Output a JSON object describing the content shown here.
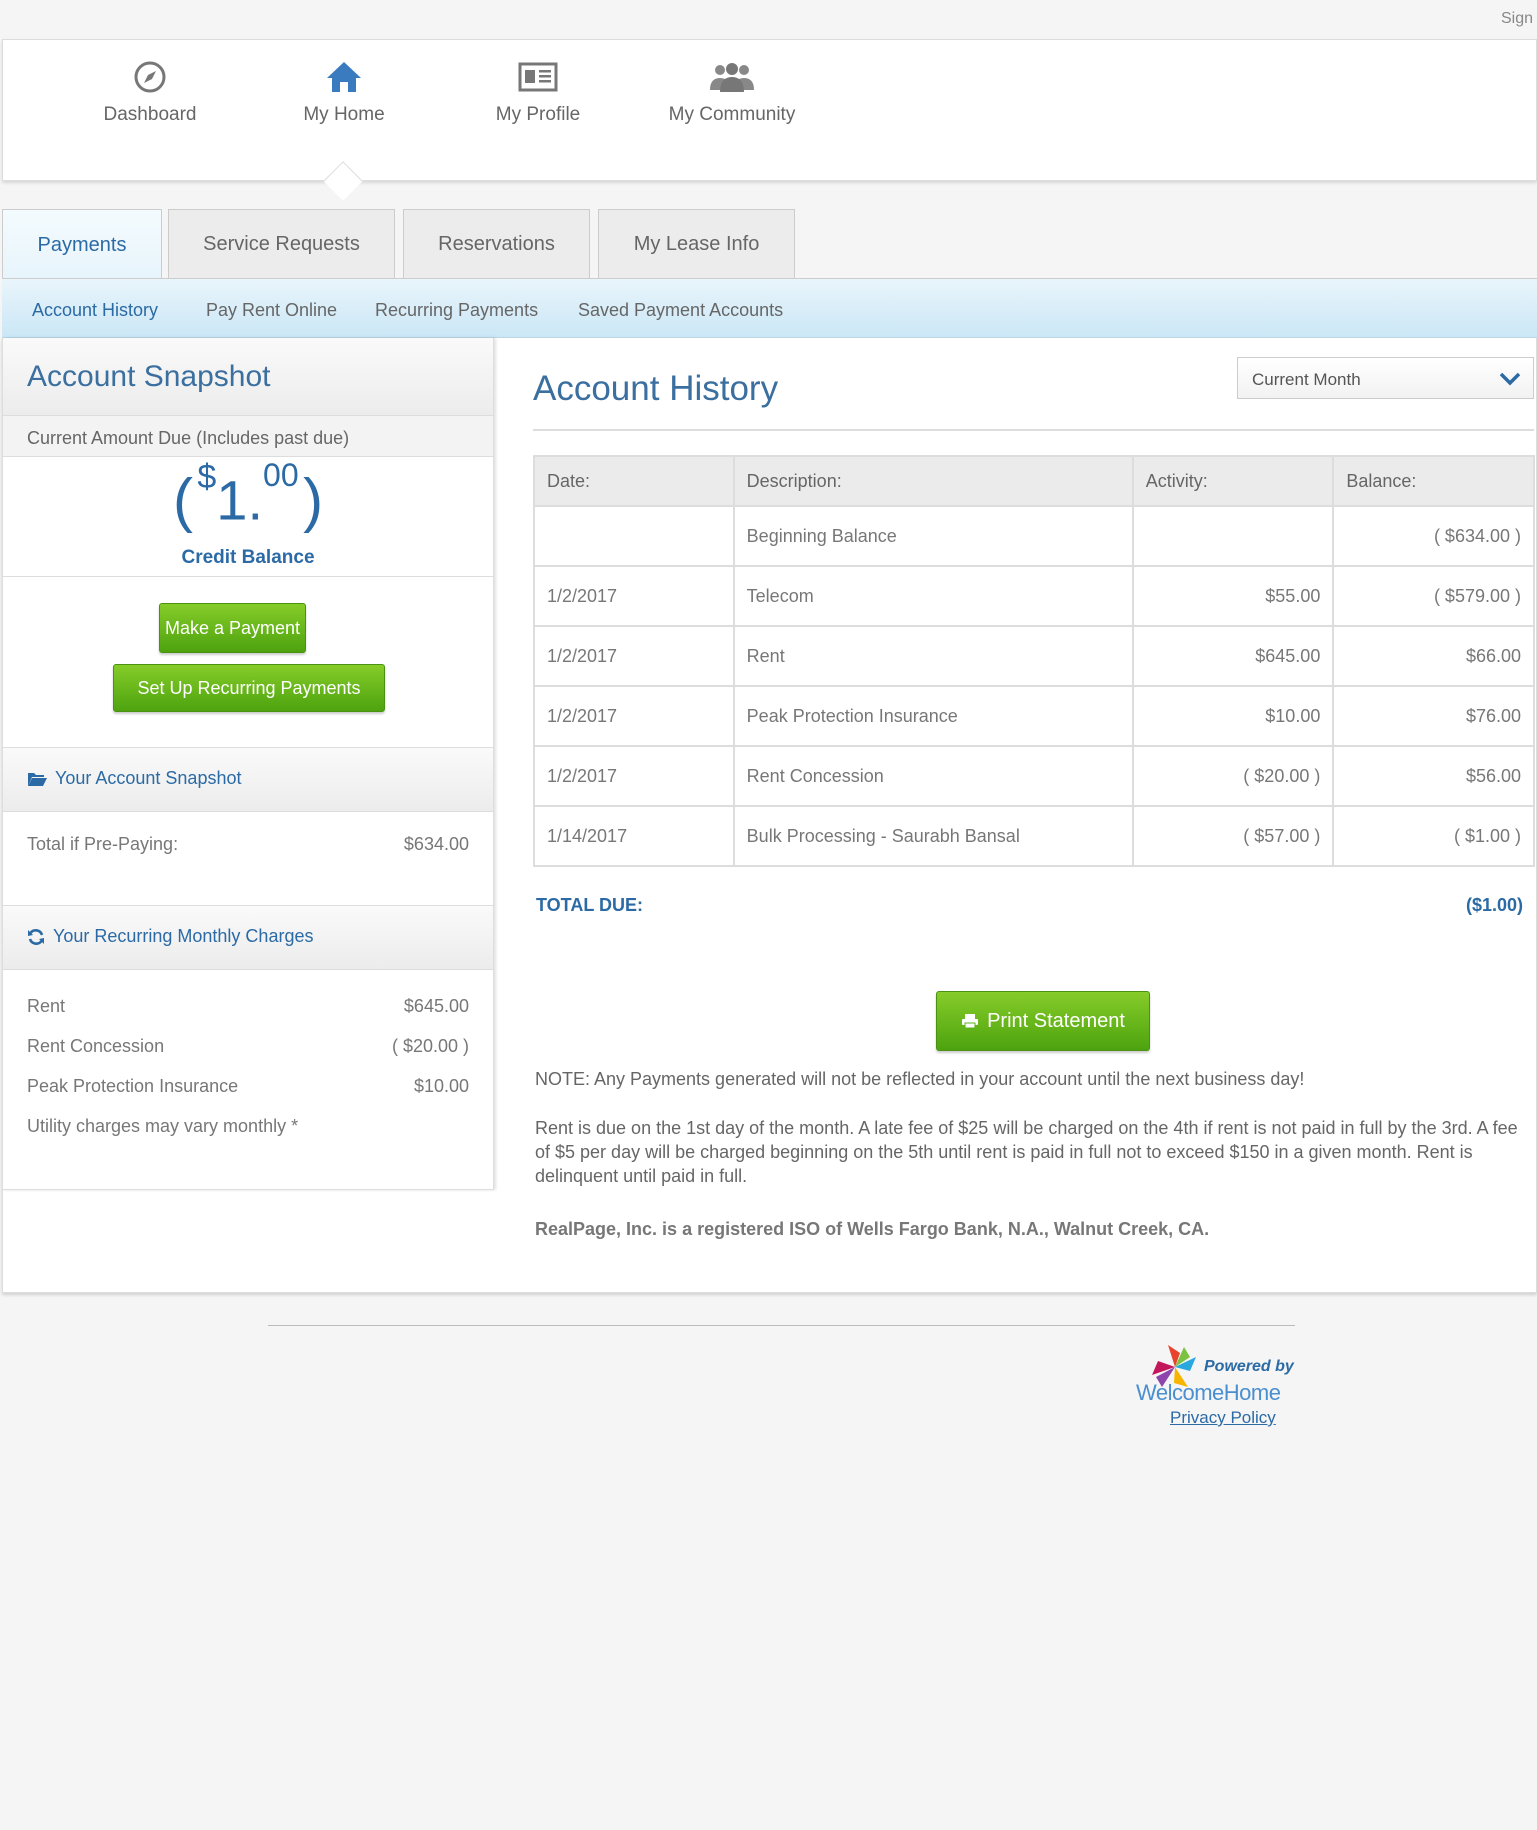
{
  "header": {
    "sign_in": "Sign"
  },
  "top_nav": [
    {
      "label": "Dashboard",
      "icon": "compass-icon"
    },
    {
      "label": "My Home",
      "icon": "home-icon"
    },
    {
      "label": "My Profile",
      "icon": "profile-card-icon"
    },
    {
      "label": "My Community",
      "icon": "community-icon"
    }
  ],
  "tabs": [
    {
      "label": "Payments",
      "active": true
    },
    {
      "label": "Service Requests"
    },
    {
      "label": "Reservations"
    },
    {
      "label": "My Lease Info"
    }
  ],
  "subnav": [
    {
      "label": "Account History",
      "active": true
    },
    {
      "label": "Pay Rent Online"
    },
    {
      "label": "Recurring Payments"
    },
    {
      "label": "Saved Payment Accounts"
    }
  ],
  "snapshot": {
    "title": "Account Snapshot",
    "due_label": "Current Amount Due (Includes past due)",
    "amount_open": "(",
    "amount_dollar": "$",
    "amount_whole": "1",
    "amount_sep": ".",
    "amount_cents": "00",
    "amount_close": ")",
    "credit_label": "Credit Balance",
    "pay_button": "Make a Payment",
    "recurring_button": "Set Up Recurring Payments",
    "account_snapshot_heading": "Your Account Snapshot",
    "prepay_label": "Total if Pre-Paying:",
    "prepay_value": "$634.00",
    "recurring_heading": "Your Recurring Monthly Charges",
    "charges": [
      {
        "label": "Rent",
        "value": "$645.00"
      },
      {
        "label": "Rent Concession",
        "value": "( $20.00 )"
      },
      {
        "label": "Peak Protection Insurance",
        "value": "$10.00"
      }
    ],
    "utility_note": "Utility charges may vary monthly *"
  },
  "history": {
    "title": "Account History",
    "period_select": "Current Month",
    "columns": [
      "Date:",
      "Description:",
      "Activity:",
      "Balance:"
    ],
    "rows": [
      {
        "date": "",
        "description": "Beginning Balance",
        "activity": "",
        "balance": "( $634.00 )"
      },
      {
        "date": "1/2/2017",
        "description": "Telecom",
        "activity": "$55.00",
        "balance": "( $579.00 )"
      },
      {
        "date": "1/2/2017",
        "description": "Rent",
        "activity": "$645.00",
        "balance": "$66.00"
      },
      {
        "date": "1/2/2017",
        "description": "Peak Protection Insurance",
        "activity": "$10.00",
        "balance": "$76.00"
      },
      {
        "date": "1/2/2017",
        "description": "Rent Concession",
        "activity": "( $20.00 )",
        "balance": "$56.00"
      },
      {
        "date": "1/14/2017",
        "description": "Bulk Processing - Saurabh Bansal",
        "activity": "( $57.00 )",
        "balance": "( $1.00 )"
      }
    ],
    "total_label": "TOTAL DUE:",
    "total_value": "($1.00)",
    "print_button": "Print Statement",
    "note1": "NOTE: Any Payments generated will not be reflected in your account until the next business day!",
    "note2": "Rent is due on the 1st day of the month. A late fee of $25 will be charged on the 4th if rent is not paid in full by the 3rd. A fee of $5 per day will be charged beginning on the 5th until rent is paid in full not to exceed $150 in a given month. Rent is delinquent until paid in full.",
    "iso_note": "RealPage, Inc. is a registered ISO of Wells Fargo Bank, N.A., Walnut Creek, CA."
  },
  "footer": {
    "powered_by": "Powered by",
    "brand": "WelcomeHome",
    "privacy": "Privacy Policy"
  },
  "colors": {
    "accent": "#2b6aa5",
    "button_green": "#5cb01a",
    "subnav_blue": "#d6edf8"
  }
}
